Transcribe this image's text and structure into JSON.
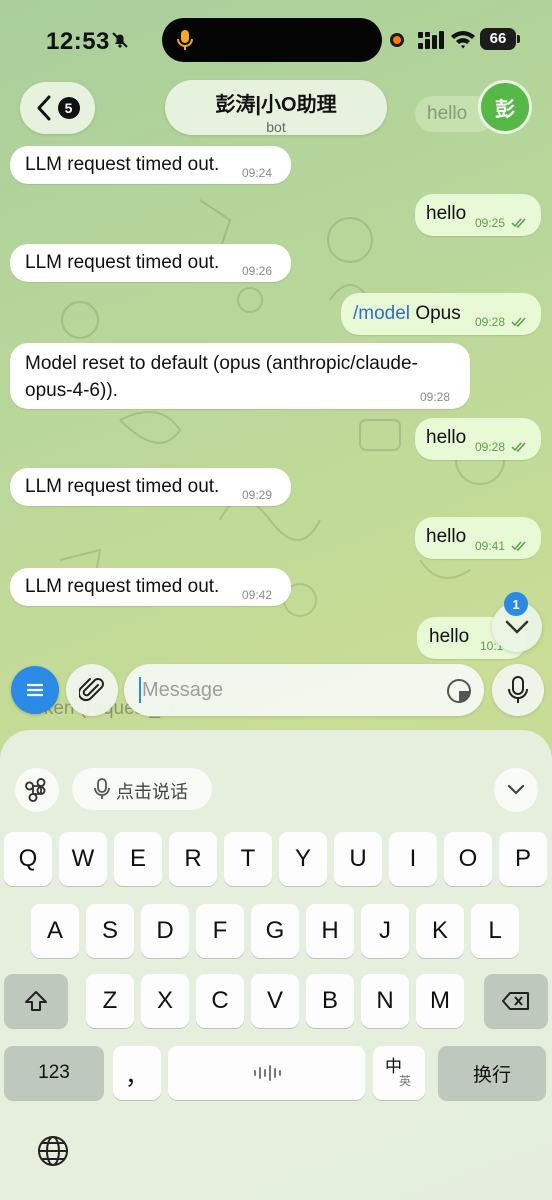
{
  "status_bar": {
    "time": "12:53",
    "battery": "66",
    "icons": [
      "bell-slash-icon",
      "microphone-indicator-icon",
      "recording-dot-icon",
      "cellular-signal-icon",
      "wifi-icon",
      "battery-icon"
    ]
  },
  "header": {
    "back_count": "5",
    "chat_name": "彭涛|小O助理",
    "chat_subtitle": "bot",
    "avatar_letter": "彭",
    "ghost_text": "hello"
  },
  "messages": [
    {
      "dir": "in",
      "text": "LLM request timed out.",
      "time": "09:24"
    },
    {
      "dir": "out",
      "text": "hello",
      "time": "09:25",
      "read": true
    },
    {
      "dir": "in",
      "text": "LLM request timed out.",
      "time": "09:26"
    },
    {
      "dir": "out",
      "command": "/model",
      "text": "Opus",
      "time": "09:28",
      "read": true
    },
    {
      "dir": "in",
      "text_line1": "Model reset to default (opus (anthropic/claude-",
      "text_line2": "opus-4-6)).",
      "time": "09:28"
    },
    {
      "dir": "out",
      "text": "hello",
      "time": "09:28",
      "read": true
    },
    {
      "dir": "in",
      "text": "LLM request timed out.",
      "time": "09:29"
    },
    {
      "dir": "out",
      "text": "hello",
      "time": "09:41",
      "read": true
    },
    {
      "dir": "in",
      "text": "LLM request timed out.",
      "time": "09:42"
    },
    {
      "dir": "out",
      "text": "hello",
      "time": "10:1"
    }
  ],
  "scroll_down": {
    "badge": "1"
  },
  "composer": {
    "placeholder": "Message",
    "ghost_text": "token (request_id."
  },
  "keyboard": {
    "voice_input_label": "点击说话",
    "row1": [
      "Q",
      "W",
      "E",
      "R",
      "T",
      "Y",
      "U",
      "I",
      "O",
      "P"
    ],
    "row2": [
      "A",
      "S",
      "D",
      "F",
      "G",
      "H",
      "J",
      "K",
      "L"
    ],
    "row3": [
      "Z",
      "X",
      "C",
      "V",
      "B",
      "N",
      "M"
    ],
    "numbers_key": "123",
    "comma_key": "，",
    "lang_key_main": "中",
    "lang_key_sub": "英",
    "return_key": "换行"
  }
}
